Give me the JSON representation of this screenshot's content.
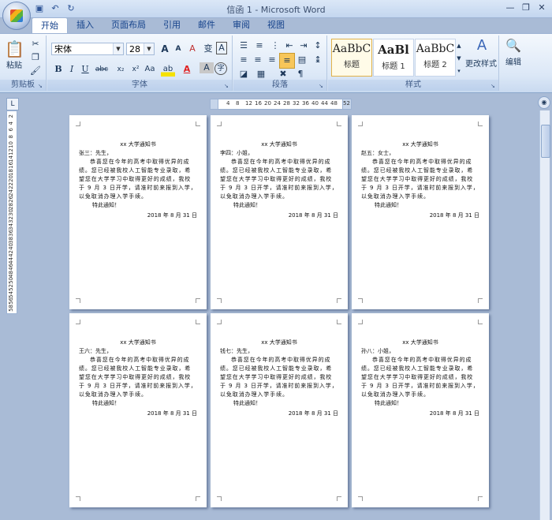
{
  "window": {
    "title": "信函 1 - Microsoft Word",
    "qat": [
      "save-icon",
      "undo-icon",
      "redo-icon"
    ],
    "controls": [
      "—",
      "❐",
      "✕"
    ]
  },
  "tabs": [
    "开始",
    "插入",
    "页面布局",
    "引用",
    "邮件",
    "审阅",
    "视图"
  ],
  "ribbon": {
    "clipboard": {
      "label": "剪贴板",
      "paste": "粘贴"
    },
    "font": {
      "label": "字体",
      "name": "宋体",
      "size": "28",
      "bold": "B",
      "italic": "I",
      "underline": "U",
      "strike": "abc",
      "sub": "x₂",
      "sup": "x²",
      "case": "Aa",
      "grow": "A",
      "shrink": "A",
      "clear": "A",
      "phonetic": "变",
      "char_border": "A",
      "highlight": "ab",
      "color": "A",
      "shade": "A",
      "circle": "字"
    },
    "paragraph": {
      "label": "段落"
    },
    "styles": {
      "label": "样式",
      "items": [
        {
          "sample": "AaBbC",
          "name": "标题"
        },
        {
          "sample": "AaBl",
          "name": "标题 1"
        },
        {
          "sample": "AaBbC",
          "name": "标题 2"
        }
      ],
      "change": "更改样式"
    },
    "editing": {
      "label": "编辑"
    }
  },
  "ruler": {
    "corner": "L",
    "h_ticks": [
      "4",
      "8",
      "12",
      "16",
      "20",
      "24",
      "28",
      "32",
      "36",
      "40",
      "44",
      "48",
      "52"
    ],
    "v_ticks": [
      "2",
      "4",
      "6",
      "8",
      "10",
      "12",
      "14",
      "16",
      "18",
      "20",
      "22",
      "24",
      "26",
      "28",
      "30",
      "32",
      "34",
      "36",
      "38",
      "40",
      "42",
      "44",
      "46",
      "48",
      "50",
      "52",
      "54",
      "56",
      "58"
    ]
  },
  "letter": {
    "title": "xx 大学通知书",
    "body": "恭喜您在今年的高考中取得优异的成绩。您已经被我校人工智能专业录取，希望您在大学学习中取得更好的成绩，我校于 9 月 3 日开学，请准时前来报到入学，以免取消办理入学手续。",
    "closing": "特此通知！",
    "date": "2018 年 8 月 31 日"
  },
  "pages": [
    {
      "recipient": "张三：先生，"
    },
    {
      "recipient": "李四：小姐，"
    },
    {
      "recipient": "赵五：女士，"
    },
    {
      "recipient": "王六：先生，"
    },
    {
      "recipient": "钱七：先生，"
    },
    {
      "recipient": "孙八：小姐，"
    }
  ]
}
